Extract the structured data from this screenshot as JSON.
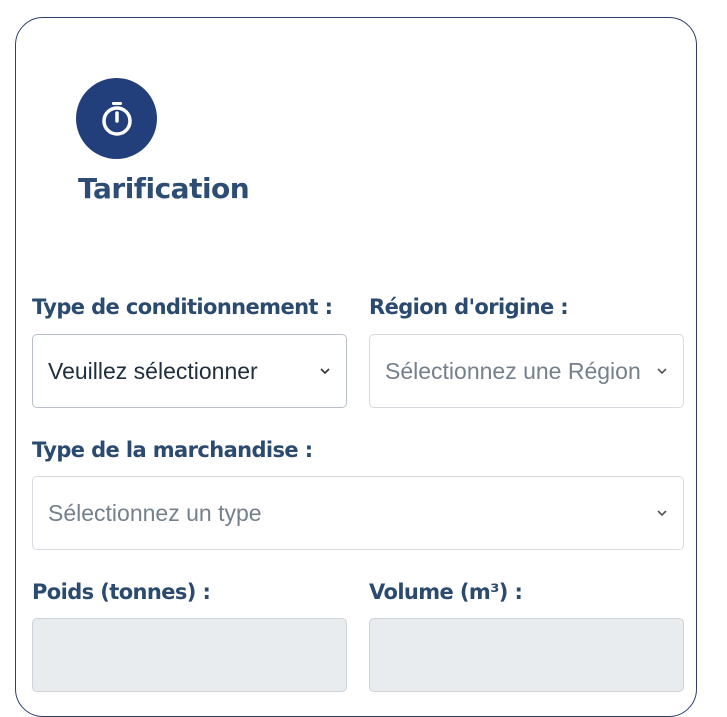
{
  "header": {
    "icon": "stopwatch-icon",
    "title": "Tarification"
  },
  "form": {
    "conditionnement": {
      "label": "Type de conditionnement :",
      "value": "Veuillez sélectionner"
    },
    "region": {
      "label": "Région d'origine :",
      "placeholder": "Sélectionnez une Région"
    },
    "marchandise": {
      "label": "Type de la marchandise :",
      "placeholder": "Sélectionnez un type"
    },
    "poids": {
      "label": "Poids (tonnes) :",
      "value": ""
    },
    "volume": {
      "label": "Volume (m³) :",
      "value": ""
    }
  },
  "colors": {
    "accent": "#223f7c",
    "label": "#2b4a6f",
    "disabled_bg": "#e9ecef"
  }
}
